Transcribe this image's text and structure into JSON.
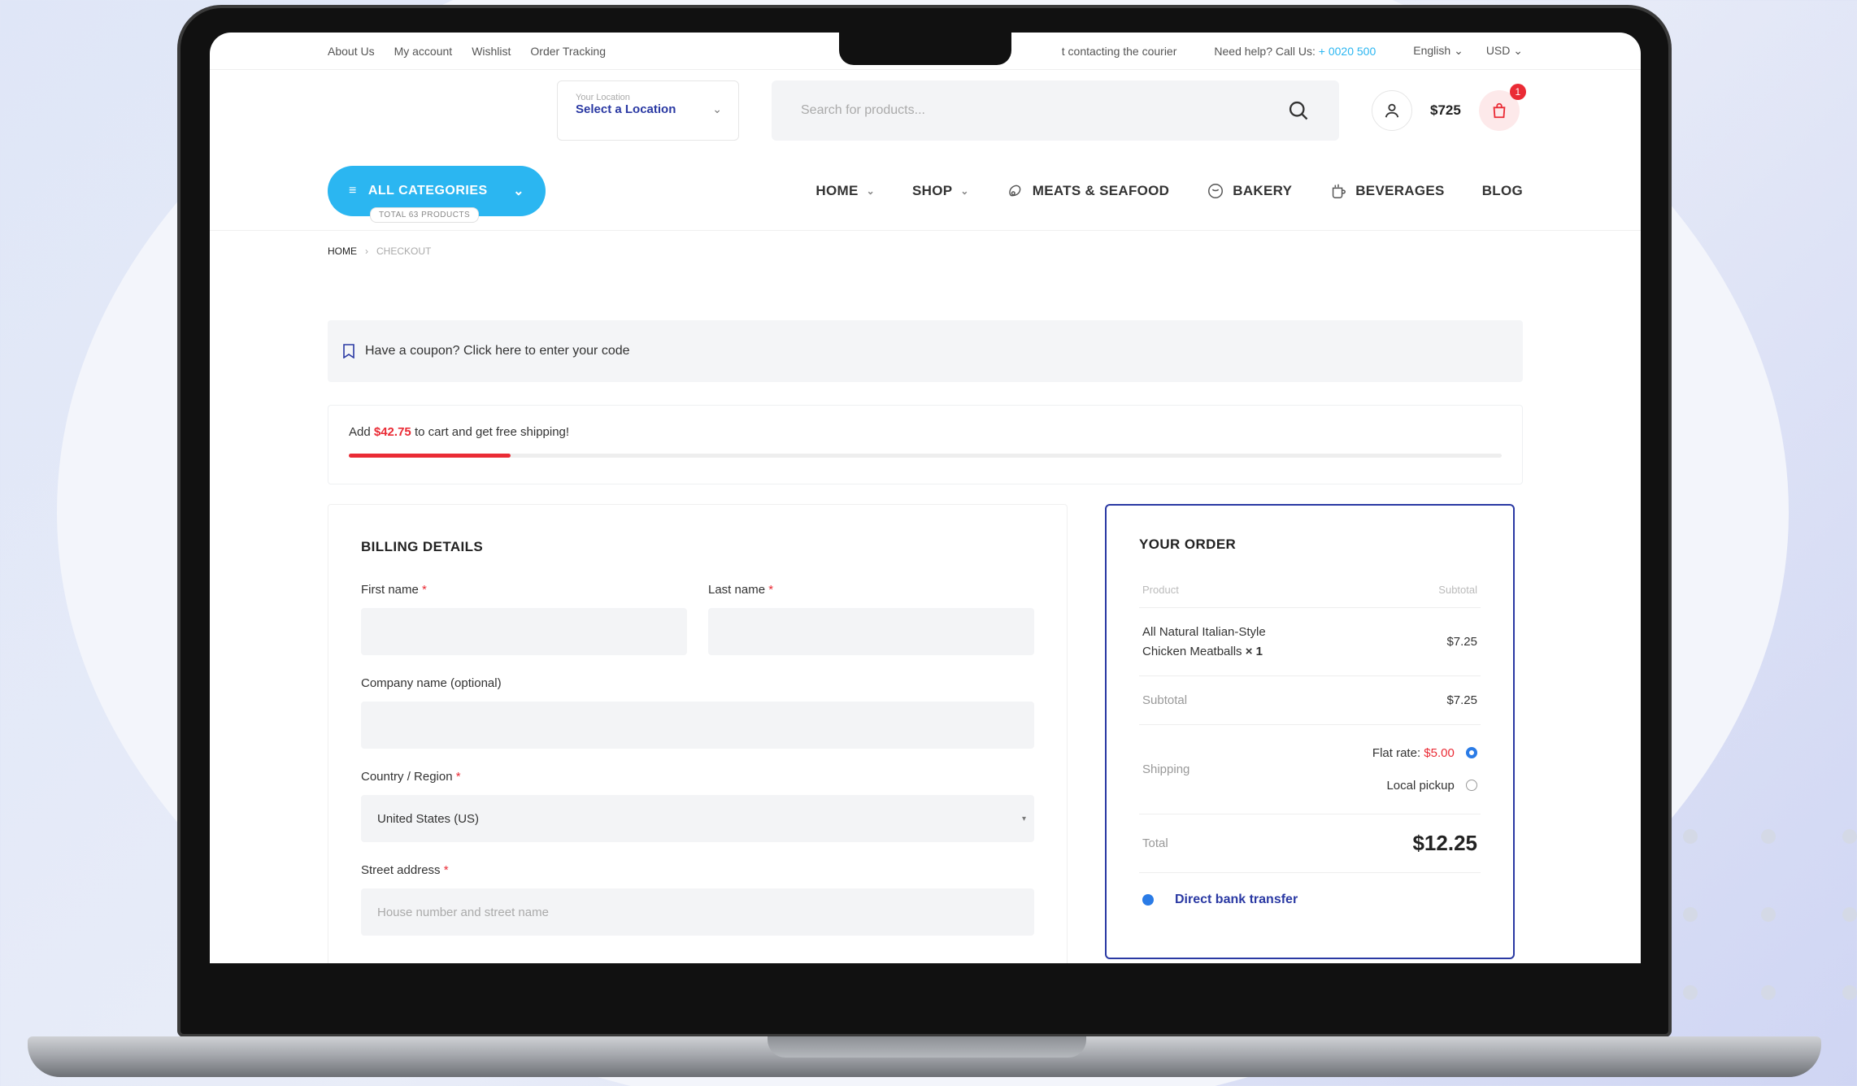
{
  "topbar": {
    "links": [
      "About Us",
      "My account",
      "Wishlist",
      "Order Tracking"
    ],
    "notice": "t contacting the courier",
    "help_prefix": "Need help? Call Us:",
    "phone": "+ 0020 500",
    "language": "English ⌄",
    "currency": "USD ⌄"
  },
  "header": {
    "location_small": "Your Location",
    "location_value": "Select a Location",
    "search_placeholder": "Search for products...",
    "cart_total": "$725",
    "cart_count": "1"
  },
  "nav": {
    "all_categories": "ALL CATEGORIES",
    "total_products": "TOTAL 63 PRODUCTS",
    "items": [
      "HOME",
      "SHOP",
      "MEATS & SEAFOOD",
      "BAKERY",
      "BEVERAGES",
      "BLOG"
    ]
  },
  "breadcrumb": {
    "home": "HOME",
    "sep": "›",
    "current": "CHECKOUT"
  },
  "coupon": {
    "text": "Have a coupon? Click here to enter your code"
  },
  "free_shipping": {
    "prefix": "Add",
    "amount": "$42.75",
    "suffix": "to cart and get free shipping!",
    "progress_percent": 14
  },
  "billing": {
    "title": "BILLING DETAILS",
    "first_name_label": "First name",
    "last_name_label": "Last name",
    "company_label": "Company name (optional)",
    "country_label": "Country / Region",
    "country_value": "United States (US)",
    "street_label": "Street address",
    "street_placeholder": "House number and street name",
    "required_mark": "*"
  },
  "order": {
    "title": "YOUR ORDER",
    "col_product": "Product",
    "col_subtotal": "Subtotal",
    "item_name": "All Natural Italian-Style Chicken Meatballs",
    "item_qty": "× 1",
    "item_price": "$7.25",
    "subtotal_label": "Subtotal",
    "subtotal_value": "$7.25",
    "shipping_label": "Shipping",
    "flat_rate_label": "Flat rate:",
    "flat_rate_value": "$5.00",
    "local_pickup_label": "Local pickup",
    "total_label": "Total",
    "total_value": "$12.25",
    "payment_method": "Direct bank transfer"
  },
  "colors": {
    "accent": "#2bb6f1",
    "brand": "#2a39a3",
    "sale": "#ea2b35"
  }
}
